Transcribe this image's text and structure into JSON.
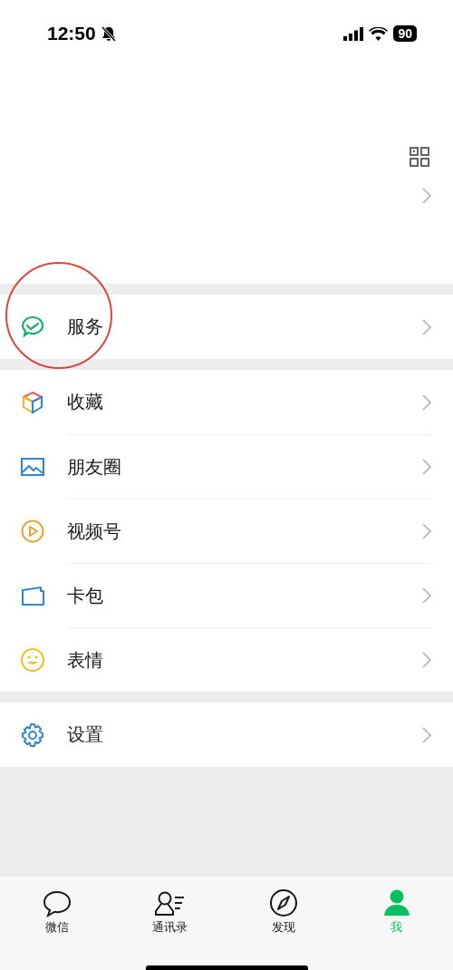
{
  "status_bar": {
    "time": "12:50",
    "battery": "90"
  },
  "menu_groups": [
    [
      {
        "kind": "service",
        "label": "服务",
        "circled": true
      }
    ],
    [
      {
        "kind": "favorites",
        "label": "收藏",
        "circled": false
      },
      {
        "kind": "moments",
        "label": "朋友圈",
        "circled": false
      },
      {
        "kind": "channels",
        "label": "视频号",
        "circled": false
      },
      {
        "kind": "cards",
        "label": "卡包",
        "circled": false
      },
      {
        "kind": "stickers",
        "label": "表情",
        "circled": false
      }
    ],
    [
      {
        "kind": "settings",
        "label": "设置",
        "circled": false
      }
    ]
  ],
  "tabs": [
    {
      "kind": "chat",
      "label": "微信",
      "selected": false
    },
    {
      "kind": "contacts",
      "label": "通讯录",
      "selected": false
    },
    {
      "kind": "discover",
      "label": "发现",
      "selected": false
    },
    {
      "kind": "me",
      "label": "我",
      "selected": true
    }
  ]
}
